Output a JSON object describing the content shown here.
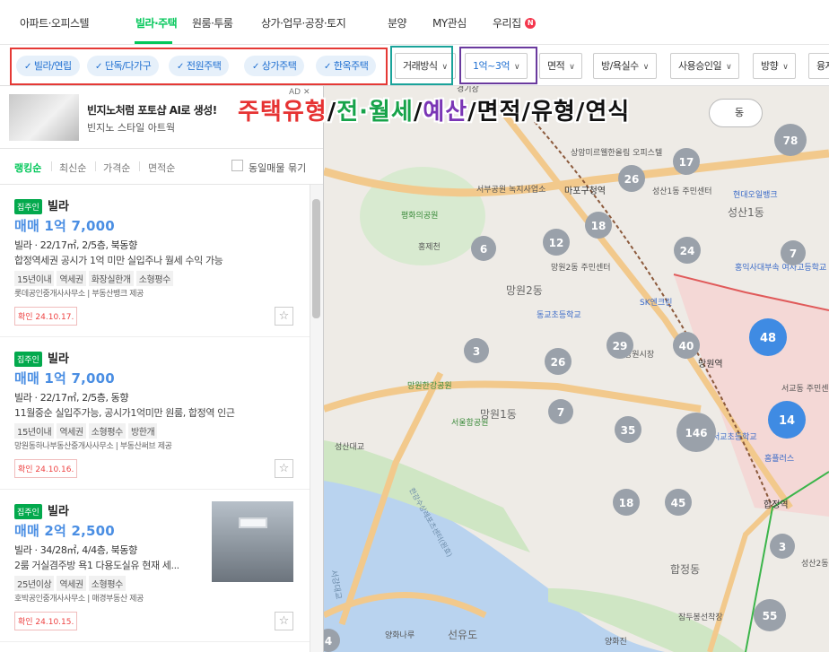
{
  "nav": {
    "items": [
      "아파트·오피스텔",
      "빌라·주택",
      "원룸·투룸",
      "상가·업무·공장·토지",
      "분양",
      "MY관심",
      "우리집"
    ],
    "new_badge": "N"
  },
  "filters": {
    "chips": [
      "빌라/연립",
      "단독/다가구",
      "전원주택",
      "상가주택",
      "한옥주택"
    ],
    "dropdowns": [
      "거래방식",
      "1억~3억",
      "면적",
      "방/욕실수",
      "사용승인일",
      "방향",
      "융자"
    ]
  },
  "ad": {
    "title": "빈지노처럼 포토샵 AI로 생성!",
    "subtitle": "빈지노 스타일 아트웍",
    "tag": "AD ✕"
  },
  "overlay": {
    "type": "주택유형",
    "trade": "전·월세",
    "budget": "예산",
    "rest": "면적/유형/연식",
    "slash": "/"
  },
  "sort": {
    "tabs": [
      "랭킹순",
      "최신순",
      "가격순",
      "면적순"
    ],
    "same_listing_label": "동일매물 묶기"
  },
  "listings": [
    {
      "badge": "집주인",
      "type": "빌라",
      "price": "매매 1억 7,000",
      "spec": "빌라 · 22/17㎡, 2/5층, 북동향",
      "desc": "합정역세권 공시가 1억 미만 실입주나 월세 수익 가능",
      "tags": [
        "15년이내",
        "역세권",
        "화장실한개",
        "소형평수"
      ],
      "agency": "롯데공인중개사사무소  |  부동산뱅크 제공",
      "confirm": "확인 24.10.17."
    },
    {
      "badge": "집주인",
      "type": "빌라",
      "price": "매매 1억 7,000",
      "spec": "빌라 · 22/17㎡, 2/5층, 동향",
      "desc": "11월중순 실입주가능, 공시가1억미만 원룸, 합정역 인근",
      "tags": [
        "15년이내",
        "역세권",
        "소형평수",
        "방한개"
      ],
      "agency": "망원동하나부동산중개사사무소  |  부동산써브 제공",
      "confirm": "확인 24.10.16."
    },
    {
      "badge": "집주인",
      "type": "빌라",
      "price": "매매 2억 2,500",
      "spec": "빌라 · 34/28㎡, 4/4층, 북동향",
      "desc": "2룸 거실겸주방 욕1 다용도실유 현재 세...",
      "tags": [
        "25년이상",
        "역세권",
        "소형평수"
      ],
      "agency": "호박공인중개사사무소  |  매경부동산 제공",
      "confirm": "확인 24.10.15."
    }
  ],
  "map": {
    "labels": [
      "성산1동",
      "상암미르웰한올림 오피스텔",
      "마포구청역",
      "서부공원 녹지사업소",
      "평화의공원",
      "홍제천",
      "망원2동",
      "망원2동 주민센터",
      "성산1동 주민센터",
      "현대오일뱅크",
      "홍익사대부속 여자고등학교",
      "동교초등학교",
      "SK엔크린",
      "망원시장",
      "망원역",
      "망원한강공원",
      "서울함공원",
      "망원1동",
      "성산대교",
      "서교동 주민센터",
      "서교초등학교",
      "홈플러스",
      "합정역",
      "한강수상레포츠센터(원효)",
      "합정동",
      "양화나루",
      "선유도",
      "잠두봉선착장",
      "양화진",
      "서강대교",
      "경기장",
      "성산2동",
      "동"
    ],
    "clusters": [
      {
        "n": 78,
        "kind": "gray"
      },
      {
        "n": 17,
        "kind": "gray"
      },
      {
        "n": 26,
        "kind": "gray"
      },
      {
        "n": 18,
        "kind": "gray"
      },
      {
        "n": 12,
        "kind": "gray"
      },
      {
        "n": 6,
        "kind": "gray"
      },
      {
        "n": 24,
        "kind": "gray"
      },
      {
        "n": 7,
        "kind": "gray"
      },
      {
        "n": 3,
        "kind": "gray"
      },
      {
        "n": 29,
        "kind": "gray"
      },
      {
        "n": 40,
        "kind": "gray"
      },
      {
        "n": 48,
        "kind": "blue"
      },
      {
        "n": 26,
        "kind": "gray"
      },
      {
        "n": 7,
        "kind": "gray"
      },
      {
        "n": 35,
        "kind": "gray"
      },
      {
        "n": 146,
        "kind": "gray"
      },
      {
        "n": 14,
        "kind": "blue"
      },
      {
        "n": 18,
        "kind": "gray"
      },
      {
        "n": 45,
        "kind": "gray"
      },
      {
        "n": 3,
        "kind": "gray"
      },
      {
        "n": 55,
        "kind": "gray"
      },
      {
        "n": 4,
        "kind": "gray"
      }
    ]
  }
}
